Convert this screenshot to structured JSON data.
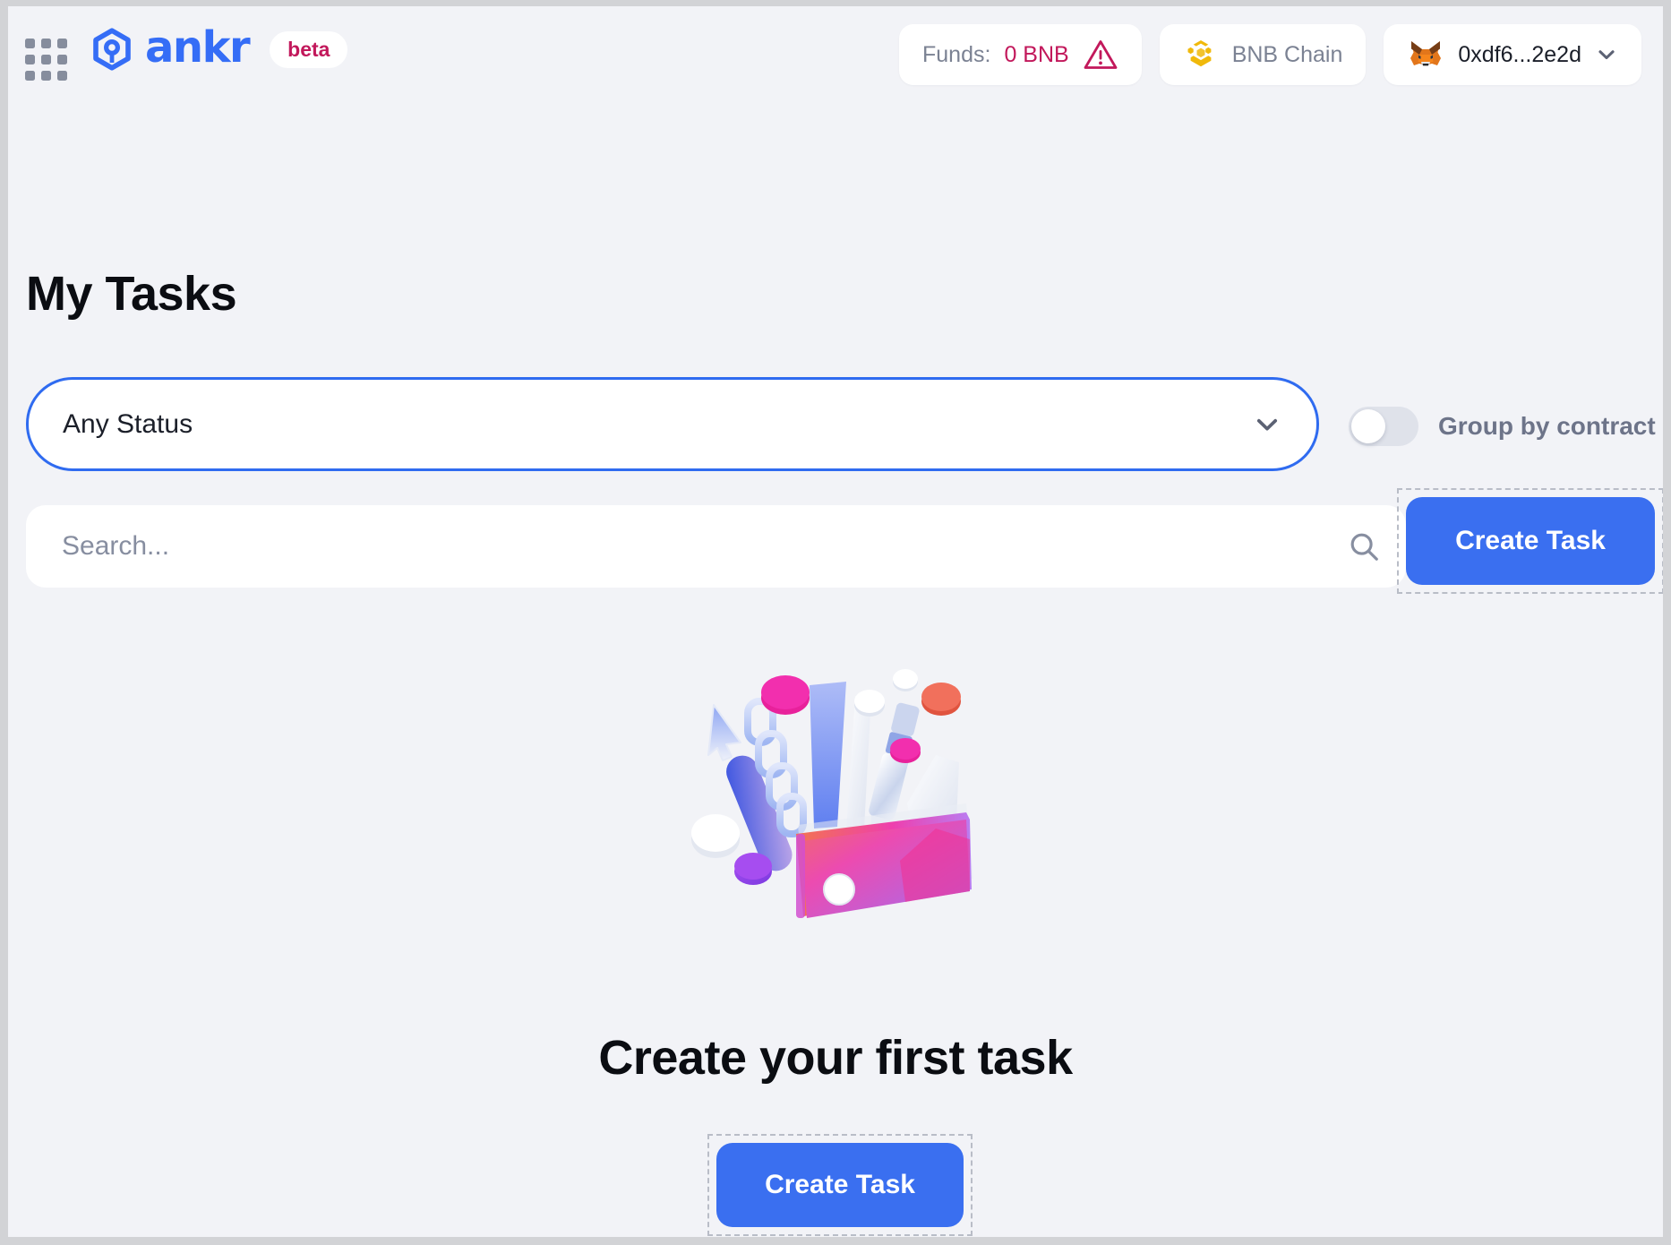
{
  "header": {
    "apps_icon": "apps-grid-icon",
    "brand_name": "ankr",
    "brand_badge": "beta",
    "funds_label": "Funds:",
    "funds_value": "0 BNB",
    "warning_icon": "warning-triangle-icon",
    "chain_icon": "bnb-chain-icon",
    "chain_name": "BNB Chain",
    "wallet_icon": "metamask-fox-icon",
    "wallet_address": "0xdf6...2e2d",
    "wallet_chevron": "chevron-down-icon"
  },
  "page": {
    "title": "My Tasks"
  },
  "filters": {
    "status_selected": "Any Status",
    "status_chevron": "chevron-down-icon",
    "group_toggle_label": "Group by contract",
    "group_toggle_on": false
  },
  "search": {
    "value": "",
    "placeholder": "Search...",
    "icon": "search-icon"
  },
  "actions": {
    "create_task_top": "Create Task",
    "create_task_bottom": "Create Task"
  },
  "empty_state": {
    "illustration": "toolbox-tools-illustration",
    "title": "Create your first task"
  },
  "colors": {
    "accent_blue": "#3a6ff0",
    "brand_blue": "#356df6",
    "crimson": "#c2185b",
    "bnb_gold": "#f0b90b",
    "background": "#f2f3f7",
    "muted_text": "#7b8293"
  }
}
